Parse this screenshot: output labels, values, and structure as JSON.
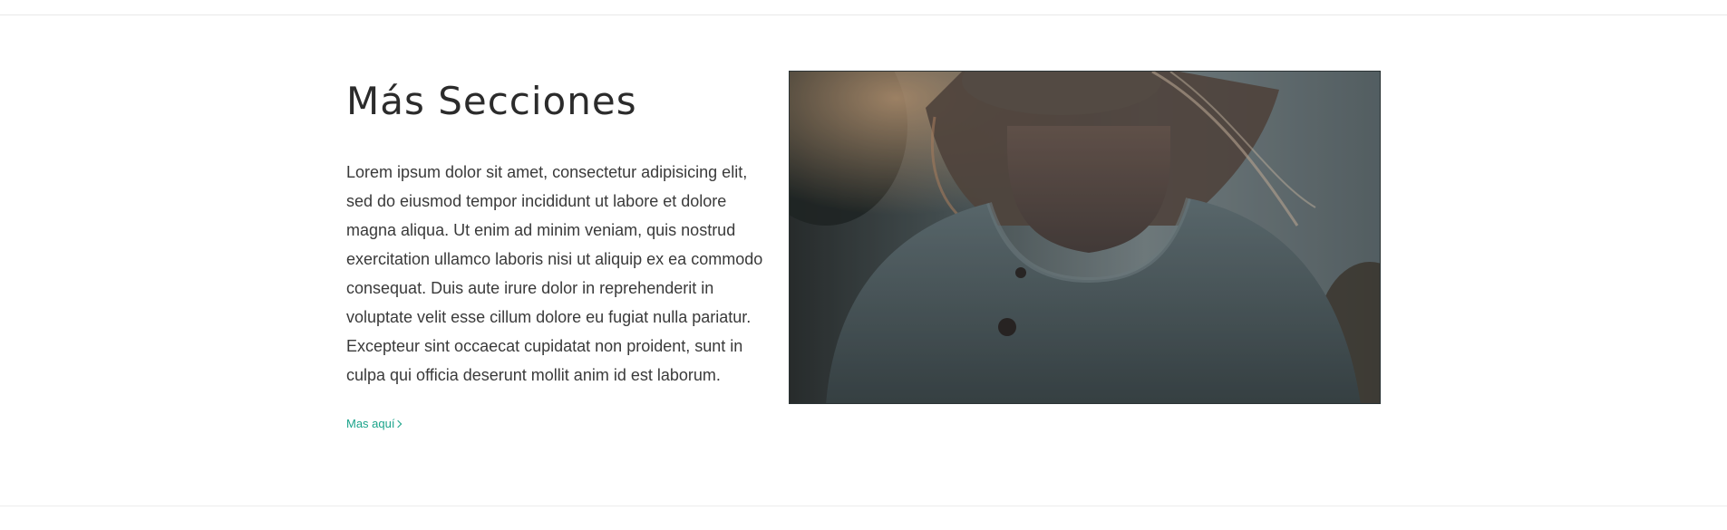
{
  "section": {
    "title": "Más Secciones",
    "body": "Lorem ipsum dolor sit amet, consectetur adipisicing elit, sed do eiusmod tempor incididunt ut labore et dolore magna aliqua. Ut enim ad minim veniam, quis nostrud exercitation ullamco laboris nisi ut aliquip ex ea commodo consequat. Duis aute irure dolor in reprehenderit in voluptate velit esse cillum dolore eu fugiat nulla pariatur. Excepteur sint occaecat cupidatat non proident, sunt in culpa qui officia deserunt mollit anim id est laborum.",
    "link_label": "Mas aquí",
    "link_icon": "chevron-right-icon"
  },
  "colors": {
    "accent": "#1aa38a",
    "heading": "#2b2b2b",
    "text": "#3a3a3a",
    "divider": "#e8e8e8"
  }
}
